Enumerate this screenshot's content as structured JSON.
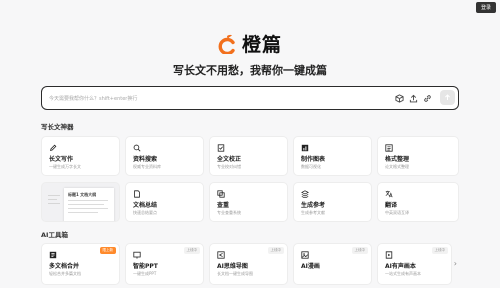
{
  "header": {
    "login_label": "登录"
  },
  "brand": {
    "name": "橙篇",
    "accent": "#f2701d"
  },
  "slogan": "写长文不用愁，我帮你一键成篇",
  "search": {
    "placeholder": "今天需要我帮你什么？shift+enter换行",
    "icons": [
      "cube-icon",
      "upload-icon",
      "link-icon",
      "send-icon"
    ]
  },
  "sections": {
    "writing_tools": "写长文神器",
    "ai_tools": "AI工具箱"
  },
  "writing_cards": [
    {
      "title": "长文写作",
      "desc": "一键生成万字长文",
      "icon": "pen-icon"
    },
    {
      "title": "资料搜索",
      "desc": "权威专业资料库",
      "icon": "search-icon"
    },
    {
      "title": "全文校正",
      "desc": "专业校对纠错",
      "icon": "check-doc-icon"
    },
    {
      "title": "制作图表",
      "desc": "数据可视化",
      "icon": "chart-icon"
    },
    {
      "title": "格式整理",
      "desc": "论文格式整理",
      "icon": "format-icon"
    },
    {
      "title": "文档总结",
      "desc": "快速总结要点",
      "icon": "doc-icon"
    },
    {
      "title": "查重",
      "desc": "专业查重系统",
      "icon": "duplicate-icon"
    },
    {
      "title": "生成参考",
      "desc": "生成参考文献",
      "icon": "reference-icon"
    },
    {
      "title": "翻译",
      "desc": "中英双语互译",
      "icon": "translate-icon"
    }
  ],
  "preview": {
    "doc_title": "标题1 文档大纲"
  },
  "ai_cards": [
    {
      "title": "多文档合并",
      "desc": "轻松合并多篇文档",
      "badge": "限上新",
      "icon": "merge-icon"
    },
    {
      "title": "智能PPT",
      "desc": "一键生成PPT",
      "badge": "上线中",
      "icon": "ppt-icon"
    },
    {
      "title": "AI思维导图",
      "desc": "长文档一键生成导图",
      "badge": "上线中",
      "icon": "mindmap-icon"
    },
    {
      "title": "AI漫画",
      "desc": "",
      "badge": "上线中",
      "icon": "comic-icon"
    },
    {
      "title": "AI有声画本",
      "desc": "一站式生成有声画本",
      "badge": "上线中",
      "icon": "audiobook-icon"
    }
  ],
  "colors": {
    "brand": "#f2701d",
    "hot_badge": "#ff8a2b",
    "background": "#f7f7f8"
  }
}
